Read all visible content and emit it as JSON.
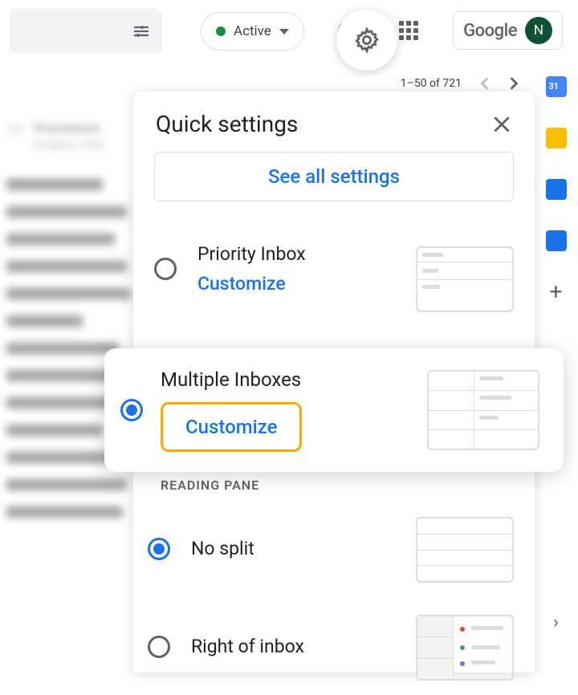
{
  "topbar": {
    "status_label": "Active",
    "google_label": "Google",
    "avatar_initial": "N"
  },
  "pagination": {
    "text": "1–50 of 721"
  },
  "promotions": {
    "title": "Promotions",
    "sub": "Dropbox, Click"
  },
  "panel": {
    "title": "Quick settings",
    "see_all": "See all settings",
    "inbox_options": [
      {
        "label": "Priority Inbox",
        "link": "Customize",
        "selected": false
      },
      {
        "label": "Multiple Inboxes",
        "link": "Customize",
        "selected": true
      }
    ],
    "section_reading": "READING PANE",
    "reading_options": [
      {
        "label": "No split",
        "selected": true
      },
      {
        "label": "Right of inbox",
        "selected": false
      }
    ]
  }
}
